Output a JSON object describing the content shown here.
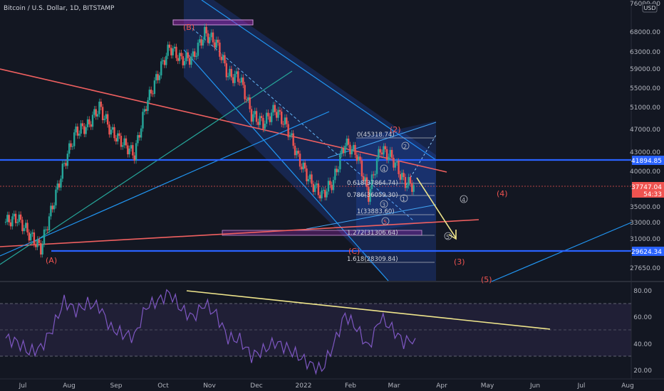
{
  "header": {
    "title": "Bitcoin / U.S. Dollar, 1D, BITSTAMP"
  },
  "currency": "USD",
  "price_axis": {
    "ticks": [
      "68000.00",
      "63000.00",
      "59000.00",
      "55000.00",
      "51000.00",
      "47000.00",
      "43000.00",
      "40000.00",
      "35000.00",
      "33000.00",
      "31000.00",
      "27650.00"
    ],
    "top_partial": "76000.00"
  },
  "price_labels": {
    "level_high": "41894.85",
    "last_price": "37747.04",
    "countdown": "54:33",
    "level_low": "29624.34"
  },
  "rsi_axis": {
    "ticks": [
      "80.00",
      "60.00",
      "40.00",
      "20.00"
    ]
  },
  "time_axis": {
    "labels": [
      "Jul",
      "Aug",
      "Sep",
      "Oct",
      "Nov",
      "Dec",
      "2022",
      "Feb",
      "Mar",
      "Apr",
      "May",
      "Jun",
      "Jul",
      "Aug"
    ]
  },
  "annotations": {
    "wave_A": "(A)",
    "wave_B": "(B)",
    "wave_C": "(C)",
    "wave_2": "(2)",
    "wave_3": "(3)",
    "wave_4": "(4)",
    "wave_5": "(5)",
    "sub_1": "1",
    "sub_2": "2",
    "sub_3": "3",
    "sub_4": "4",
    "sub_5": "5",
    "sub_4_future": "4",
    "sub_5_future": "5",
    "fib": [
      "0(45318.74)",
      "0.618(37864.74)",
      "0.786(36059.30)",
      "1(33883.60)",
      "1.272(31306.64)",
      "1.618(28309.84)"
    ]
  },
  "colors": {
    "background": "#131722",
    "bull": "#26a69a",
    "bear": "#ef5350",
    "level_line": "#2962ff",
    "rsi": "#7e57c2",
    "trend": "#f06060",
    "yellow": "#f0e68c"
  },
  "chart_data": [
    {
      "type": "candlestick",
      "title": "Bitcoin / U.S. Dollar, 1D, BITSTAMP",
      "ylabel": "USD",
      "ylim": [
        26500,
        76000
      ],
      "horizontal_levels": [
        41894.85,
        29624.34
      ],
      "last_price": 37747.04,
      "fib_levels": [
        {
          "ratio": 0,
          "price": 45318.74
        },
        {
          "ratio": 0.618,
          "price": 37864.74
        },
        {
          "ratio": 0.786,
          "price": 36059.3
        },
        {
          "ratio": 1,
          "price": 33883.6
        },
        {
          "ratio": 1.272,
          "price": 31306.64
        },
        {
          "ratio": 1.618,
          "price": 28309.84
        }
      ],
      "x": [
        "Jun 25",
        "Jul 5",
        "Jul 15",
        "Jul 20",
        "Jul 25",
        "Aug 5",
        "Aug 15",
        "Aug 25",
        "Sep 5",
        "Sep 10",
        "Sep 20",
        "Sep 28",
        "Oct 6",
        "Oct 15",
        "Oct 20",
        "Oct 25",
        "Nov 1",
        "Nov 10",
        "Nov 15",
        "Nov 25",
        "Dec 1",
        "Dec 5",
        "Dec 15",
        "Dec 25",
        "Jan 1",
        "Jan 10",
        "Jan 20",
        "Jan 24",
        "Feb 1",
        "Feb 10",
        "Feb 15",
        "Feb 24",
        "Mar 1",
        "Mar 3",
        "Mar 8",
        "Mar 12"
      ],
      "close": [
        33000,
        33500,
        31500,
        29800,
        35000,
        41000,
        46500,
        47500,
        51000,
        46500,
        44500,
        42500,
        51500,
        57500,
        64000,
        61000,
        61500,
        67500,
        65000,
        57500,
        57000,
        49500,
        48000,
        50500,
        47500,
        41800,
        38500,
        36500,
        38500,
        44500,
        42500,
        36500,
        43500,
        42000,
        38500,
        37747
      ]
    },
    {
      "type": "line",
      "title": "RSI",
      "ylim": [
        15,
        85
      ],
      "x": [
        "Jun 25",
        "Jul 5",
        "Jul 15",
        "Jul 20",
        "Jul 25",
        "Aug 5",
        "Aug 15",
        "Aug 25",
        "Sep 5",
        "Sep 10",
        "Sep 20",
        "Sep 28",
        "Oct 6",
        "Oct 15",
        "Oct 20",
        "Oct 25",
        "Nov 1",
        "Nov 10",
        "Nov 15",
        "Nov 25",
        "Dec 1",
        "Dec 5",
        "Dec 15",
        "Dec 25",
        "Jan 1",
        "Jan 10",
        "Jan 20",
        "Jan 24",
        "Feb 1",
        "Feb 10",
        "Feb 15",
        "Feb 24",
        "Mar 1",
        "Mar 3",
        "Mar 8",
        "Mar 12"
      ],
      "values": [
        45,
        42,
        35,
        38,
        52,
        72,
        65,
        70,
        68,
        52,
        48,
        46,
        68,
        72,
        78,
        66,
        60,
        70,
        62,
        45,
        44,
        32,
        36,
        42,
        38,
        32,
        26,
        22,
        40,
        62,
        52,
        38,
        60,
        52,
        42,
        45
      ]
    }
  ]
}
